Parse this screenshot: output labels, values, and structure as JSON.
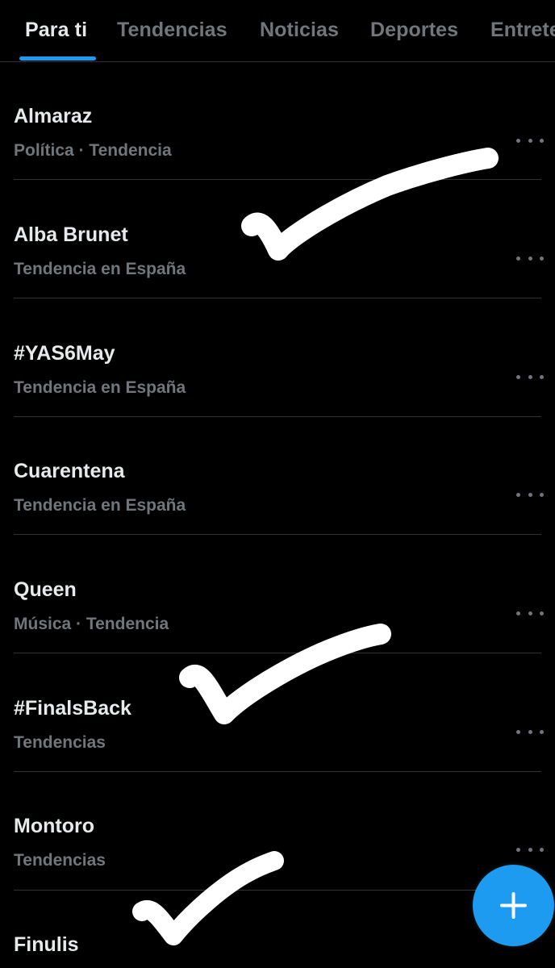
{
  "tabs": [
    {
      "label": "Para ti",
      "active": true
    },
    {
      "label": "Tendencias",
      "active": false
    },
    {
      "label": "Noticias",
      "active": false
    },
    {
      "label": "Deportes",
      "active": false
    },
    {
      "label": "Entretenimiento",
      "active": false
    }
  ],
  "trends": [
    {
      "name": "Almaraz",
      "meta": "Política · Tendencia"
    },
    {
      "name": "Alba Brunet",
      "meta": "Tendencia en España"
    },
    {
      "name": "#YAS6May",
      "meta": "Tendencia en España"
    },
    {
      "name": "Cuarentena",
      "meta": "Tendencia en España"
    },
    {
      "name": "Queen",
      "meta": "Música · Tendencia"
    },
    {
      "name": "#FinalsBack",
      "meta": "Tendencias"
    },
    {
      "name": "Montoro",
      "meta": "Tendencias"
    },
    {
      "name": "Finulis",
      "meta": ""
    }
  ],
  "icons": {
    "more": "more-horizontal-icon",
    "compose": "plus-icon"
  },
  "colors": {
    "background": "#000000",
    "accent": "#1d9bf0",
    "primary_text": "#e7e9ea",
    "secondary_text": "#71767b",
    "divider": "#2f3336",
    "handwritten_checkmarks": "#ffffff"
  }
}
